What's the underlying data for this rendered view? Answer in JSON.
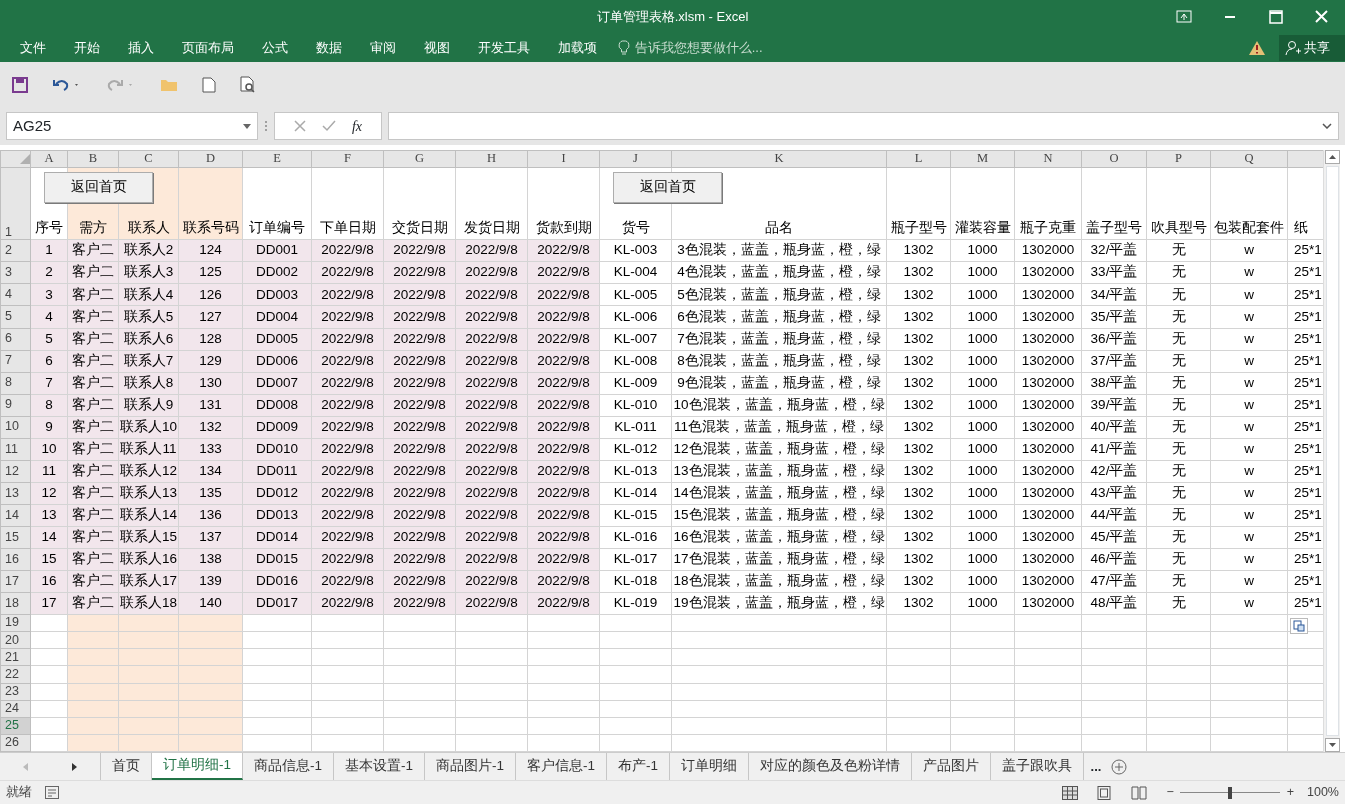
{
  "window": {
    "title": "订单管理表格.xlsm - Excel"
  },
  "ribbon_tabs": [
    {
      "label": "文件"
    },
    {
      "label": "开始"
    },
    {
      "label": "插入"
    },
    {
      "label": "页面布局"
    },
    {
      "label": "公式"
    },
    {
      "label": "数据"
    },
    {
      "label": "审阅"
    },
    {
      "label": "视图"
    },
    {
      "label": "开发工具"
    },
    {
      "label": "加载项"
    }
  ],
  "tell_me": {
    "placeholder": "告诉我您想要做什么..."
  },
  "share_button": {
    "label": "共享"
  },
  "name_box": {
    "value": "AG25"
  },
  "formula_bar": {
    "fx": "fx"
  },
  "header_row_number": "1",
  "columns": [
    {
      "letter": "A",
      "header": "序号",
      "band": false,
      "tint": true
    },
    {
      "letter": "B",
      "header": "需方",
      "band": true,
      "tint": true
    },
    {
      "letter": "C",
      "header": "联系人",
      "band": true,
      "tint": true
    },
    {
      "letter": "D",
      "header": "联系号码",
      "band": true,
      "tint": true
    },
    {
      "letter": "E",
      "header": "订单编号",
      "band": false,
      "tint": true
    },
    {
      "letter": "F",
      "header": "下单日期",
      "band": false,
      "tint": true
    },
    {
      "letter": "G",
      "header": "交货日期",
      "band": false,
      "tint": true
    },
    {
      "letter": "H",
      "header": "发货日期",
      "band": false,
      "tint": true
    },
    {
      "letter": "I",
      "header": "货款到期",
      "band": false,
      "tint": true
    },
    {
      "letter": "J",
      "header": "货号",
      "band": false,
      "tint": false
    },
    {
      "letter": "K",
      "header": "品名",
      "band": false,
      "tint": false
    },
    {
      "letter": "L",
      "header": "瓶子型号",
      "band": false,
      "tint": false
    },
    {
      "letter": "M",
      "header": "灌装容量",
      "band": false,
      "tint": false
    },
    {
      "letter": "N",
      "header": "瓶子克重",
      "band": false,
      "tint": false
    },
    {
      "letter": "O",
      "header": "盖子型号",
      "band": false,
      "tint": false
    },
    {
      "letter": "P",
      "header": "吹具型号",
      "band": false,
      "tint": false
    },
    {
      "letter": "Q",
      "header": "包装配套件",
      "band": false,
      "tint": false
    },
    {
      "header": "纸",
      "band": false,
      "tint": false
    }
  ],
  "sheet_buttons": [
    {
      "label": "返回首页"
    },
    {
      "label": "返回首页"
    }
  ],
  "rows": [
    {
      "number": "2",
      "selected": false,
      "cells": [
        "1",
        "客户二",
        "联系人2",
        "124",
        "DD001",
        "2022/9/8",
        "2022/9/8",
        "2022/9/8",
        "2022/9/8",
        "KL-003",
        "3色混装，蓝盖，瓶身蓝，橙，绿",
        "1302",
        "1000",
        "1302000",
        "32/平盖",
        "无",
        "w",
        "25*1"
      ]
    },
    {
      "number": "3",
      "selected": false,
      "cells": [
        "2",
        "客户二",
        "联系人3",
        "125",
        "DD002",
        "2022/9/8",
        "2022/9/8",
        "2022/9/8",
        "2022/9/8",
        "KL-004",
        "4色混装，蓝盖，瓶身蓝，橙，绿",
        "1302",
        "1000",
        "1302000",
        "33/平盖",
        "无",
        "w",
        "25*1"
      ]
    },
    {
      "number": "4",
      "selected": false,
      "cells": [
        "3",
        "客户二",
        "联系人4",
        "126",
        "DD003",
        "2022/9/8",
        "2022/9/8",
        "2022/9/8",
        "2022/9/8",
        "KL-005",
        "5色混装，蓝盖，瓶身蓝，橙，绿",
        "1302",
        "1000",
        "1302000",
        "34/平盖",
        "无",
        "w",
        "25*1"
      ]
    },
    {
      "number": "5",
      "selected": false,
      "cells": [
        "4",
        "客户二",
        "联系人5",
        "127",
        "DD004",
        "2022/9/8",
        "2022/9/8",
        "2022/9/8",
        "2022/9/8",
        "KL-006",
        "6色混装，蓝盖，瓶身蓝，橙，绿",
        "1302",
        "1000",
        "1302000",
        "35/平盖",
        "无",
        "w",
        "25*1"
      ]
    },
    {
      "number": "6",
      "selected": false,
      "cells": [
        "5",
        "客户二",
        "联系人6",
        "128",
        "DD005",
        "2022/9/8",
        "2022/9/8",
        "2022/9/8",
        "2022/9/8",
        "KL-007",
        "7色混装，蓝盖，瓶身蓝，橙，绿",
        "1302",
        "1000",
        "1302000",
        "36/平盖",
        "无",
        "w",
        "25*1"
      ]
    },
    {
      "number": "7",
      "selected": false,
      "cells": [
        "6",
        "客户二",
        "联系人7",
        "129",
        "DD006",
        "2022/9/8",
        "2022/9/8",
        "2022/9/8",
        "2022/9/8",
        "KL-008",
        "8色混装，蓝盖，瓶身蓝，橙，绿",
        "1302",
        "1000",
        "1302000",
        "37/平盖",
        "无",
        "w",
        "25*1"
      ]
    },
    {
      "number": "8",
      "selected": false,
      "cells": [
        "7",
        "客户二",
        "联系人8",
        "130",
        "DD007",
        "2022/9/8",
        "2022/9/8",
        "2022/9/8",
        "2022/9/8",
        "KL-009",
        "9色混装，蓝盖，瓶身蓝，橙，绿",
        "1302",
        "1000",
        "1302000",
        "38/平盖",
        "无",
        "w",
        "25*1"
      ]
    },
    {
      "number": "9",
      "selected": false,
      "cells": [
        "8",
        "客户二",
        "联系人9",
        "131",
        "DD008",
        "2022/9/8",
        "2022/9/8",
        "2022/9/8",
        "2022/9/8",
        "KL-010",
        "10色混装，蓝盖，瓶身蓝，橙，绿",
        "1302",
        "1000",
        "1302000",
        "39/平盖",
        "无",
        "w",
        "25*1"
      ]
    },
    {
      "number": "10",
      "selected": false,
      "cells": [
        "9",
        "客户二",
        "联系人10",
        "132",
        "DD009",
        "2022/9/8",
        "2022/9/8",
        "2022/9/8",
        "2022/9/8",
        "KL-011",
        "11色混装，蓝盖，瓶身蓝，橙，绿",
        "1302",
        "1000",
        "1302000",
        "40/平盖",
        "无",
        "w",
        "25*1"
      ]
    },
    {
      "number": "11",
      "selected": false,
      "cells": [
        "10",
        "客户二",
        "联系人11",
        "133",
        "DD010",
        "2022/9/8",
        "2022/9/8",
        "2022/9/8",
        "2022/9/8",
        "KL-012",
        "12色混装，蓝盖，瓶身蓝，橙，绿",
        "1302",
        "1000",
        "1302000",
        "41/平盖",
        "无",
        "w",
        "25*1"
      ]
    },
    {
      "number": "12",
      "selected": false,
      "cells": [
        "11",
        "客户二",
        "联系人12",
        "134",
        "DD011",
        "2022/9/8",
        "2022/9/8",
        "2022/9/8",
        "2022/9/8",
        "KL-013",
        "13色混装，蓝盖，瓶身蓝，橙，绿",
        "1302",
        "1000",
        "1302000",
        "42/平盖",
        "无",
        "w",
        "25*1"
      ]
    },
    {
      "number": "13",
      "selected": false,
      "cells": [
        "12",
        "客户二",
        "联系人13",
        "135",
        "DD012",
        "2022/9/8",
        "2022/9/8",
        "2022/9/8",
        "2022/9/8",
        "KL-014",
        "14色混装，蓝盖，瓶身蓝，橙，绿",
        "1302",
        "1000",
        "1302000",
        "43/平盖",
        "无",
        "w",
        "25*1"
      ]
    },
    {
      "number": "14",
      "selected": false,
      "cells": [
        "13",
        "客户二",
        "联系人14",
        "136",
        "DD013",
        "2022/9/8",
        "2022/9/8",
        "2022/9/8",
        "2022/9/8",
        "KL-015",
        "15色混装，蓝盖，瓶身蓝，橙，绿",
        "1302",
        "1000",
        "1302000",
        "44/平盖",
        "无",
        "w",
        "25*1"
      ]
    },
    {
      "number": "15",
      "selected": false,
      "cells": [
        "14",
        "客户二",
        "联系人15",
        "137",
        "DD014",
        "2022/9/8",
        "2022/9/8",
        "2022/9/8",
        "2022/9/8",
        "KL-016",
        "16色混装，蓝盖，瓶身蓝，橙，绿",
        "1302",
        "1000",
        "1302000",
        "45/平盖",
        "无",
        "w",
        "25*1"
      ]
    },
    {
      "number": "16",
      "selected": false,
      "cells": [
        "15",
        "客户二",
        "联系人16",
        "138",
        "DD015",
        "2022/9/8",
        "2022/9/8",
        "2022/9/8",
        "2022/9/8",
        "KL-017",
        "17色混装，蓝盖，瓶身蓝，橙，绿",
        "1302",
        "1000",
        "1302000",
        "46/平盖",
        "无",
        "w",
        "25*1"
      ]
    },
    {
      "number": "17",
      "selected": false,
      "cells": [
        "16",
        "客户二",
        "联系人17",
        "139",
        "DD016",
        "2022/9/8",
        "2022/9/8",
        "2022/9/8",
        "2022/9/8",
        "KL-018",
        "18色混装，蓝盖，瓶身蓝，橙，绿",
        "1302",
        "1000",
        "1302000",
        "47/平盖",
        "无",
        "w",
        "25*1"
      ]
    },
    {
      "number": "18",
      "selected": false,
      "cells": [
        "17",
        "客户二",
        "联系人18",
        "140",
        "DD017",
        "2022/9/8",
        "2022/9/8",
        "2022/9/8",
        "2022/9/8",
        "KL-019",
        "19色混装，蓝盖，瓶身蓝，橙，绿",
        "1302",
        "1000",
        "1302000",
        "48/平盖",
        "无",
        "w",
        "25*1"
      ]
    },
    {
      "number": "19",
      "selected": false
    },
    {
      "number": "20",
      "selected": false
    },
    {
      "number": "21",
      "selected": false
    },
    {
      "number": "22",
      "selected": false
    },
    {
      "number": "23",
      "selected": false
    },
    {
      "number": "24",
      "selected": false
    },
    {
      "number": "25",
      "selected": true
    },
    {
      "number": "26",
      "selected": false
    }
  ],
  "sheet_tabs": [
    {
      "label": "首页",
      "selected": false
    },
    {
      "label": "订单明细-1",
      "selected": true
    },
    {
      "label": "商品信息-1",
      "selected": false
    },
    {
      "label": "基本设置-1",
      "selected": false
    },
    {
      "label": "商品图片-1",
      "selected": false
    },
    {
      "label": "客户信息-1",
      "selected": false
    },
    {
      "label": "布产-1",
      "selected": false
    },
    {
      "label": "订单明细",
      "selected": false
    },
    {
      "label": "对应的颜色及色粉详情",
      "selected": false
    },
    {
      "label": "产品图片",
      "selected": false
    },
    {
      "label": "盖子跟吹具",
      "selected": false
    }
  ],
  "more_tabs": "...",
  "status_bar": {
    "status": "就绪",
    "zoom": {
      "level": 0.5,
      "minus": "−",
      "plus": "+",
      "reading": "100%"
    }
  }
}
